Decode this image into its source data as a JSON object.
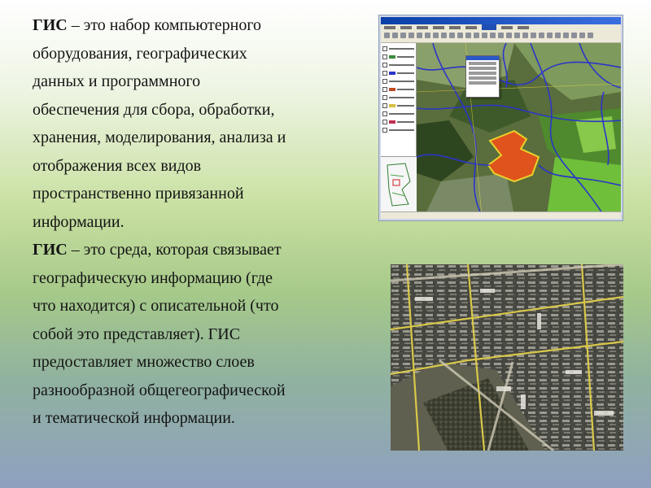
{
  "slide": {
    "paragraphs": [
      {
        "term": "ГИС",
        "lines_rest": [
          " – это набор компьютерного",
          "оборудования, географических",
          "данных и программного",
          "обеспечения для сбора, обработки,",
          "хранения, моделирования, анализа и",
          "отображения всех видов",
          "пространственно привязанной",
          "информации."
        ]
      },
      {
        "term": "ГИС",
        "lines_rest": [
          " – это среда, которая связывает",
          "географическую информацию (где",
          "что находится) с описательной (что",
          "собой это представляет). ГИС",
          "предоставляет множество слоев",
          "разнообразной общегеографической",
          "и тематической информации."
        ]
      }
    ]
  },
  "images": {
    "gis_screenshot": "gis-software-window",
    "satellite_photo": "urban-aerial-photo"
  },
  "colors": {
    "text": "#141414",
    "road_blue": "#2b35c8",
    "parcel_orange": "#e0531c",
    "parcel_outline": "#e8d22a",
    "sat_road_yellow": "#d9c84a"
  }
}
